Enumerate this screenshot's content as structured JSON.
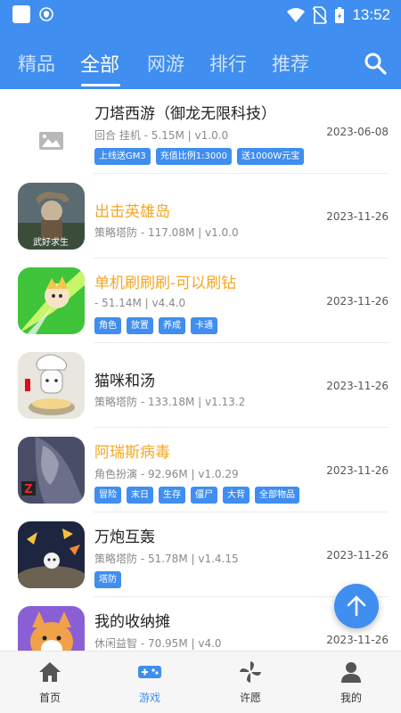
{
  "status_bar": {
    "time": "13:52"
  },
  "tabs": [
    "精品",
    "全部",
    "网游",
    "排行",
    "推荐"
  ],
  "active_tab": "全部",
  "games": [
    {
      "title": "刀塔西游（御龙无限科技）",
      "meta": "回合 挂机 - 5.15M | v1.0.0",
      "date": "2023-06-08",
      "tags": [
        "上线送GM3",
        "充值比例1:3000",
        "送1000W元宝"
      ],
      "highlight": false,
      "icon": "image-placeholder-icon"
    },
    {
      "title": "出击英雄岛",
      "meta": "策略塔防 - 117.08M | v1.0.0",
      "date": "2023-11-26",
      "tags": [],
      "highlight": true,
      "icon": "hero-island-game-icon"
    },
    {
      "title": "单机刷刷刷-可以刷钻",
      "meta": " - 51.14M | v4.4.0",
      "date": "2023-11-26",
      "tags": [
        "角色",
        "放置",
        "养成",
        "卡通"
      ],
      "highlight": true,
      "icon": "green-burst-game-icon"
    },
    {
      "title": "猫咪和汤",
      "meta": "策略塔防 - 133.18M | v1.13.2",
      "date": "2023-11-26",
      "tags": [],
      "highlight": false,
      "icon": "cat-chef-game-icon"
    },
    {
      "title": "阿瑞斯病毒",
      "meta": "角色扮演 - 92.96M | v1.0.29",
      "date": "2023-11-26",
      "tags": [
        "冒险",
        "末日",
        "生存",
        "僵尸",
        "大背",
        "全部物品"
      ],
      "highlight": true,
      "icon": "ares-virus-game-icon"
    },
    {
      "title": "万炮互轰",
      "meta": "策略塔防 - 51.78M | v1.4.15",
      "date": "2023-11-26",
      "tags": [
        "塔防"
      ],
      "highlight": false,
      "icon": "cannon-game-icon"
    },
    {
      "title": "我的收纳摊",
      "meta": "休闲益智 - 70.95M | v4.0",
      "date": "2023-11-26",
      "tags": [],
      "highlight": false,
      "icon": "corgi-game-icon"
    }
  ],
  "bottom_nav": [
    {
      "label": "首页",
      "icon": "home-icon"
    },
    {
      "label": "游戏",
      "icon": "gamepad-icon"
    },
    {
      "label": "许愿",
      "icon": "pinwheel-icon"
    },
    {
      "label": "我的",
      "icon": "user-icon"
    }
  ],
  "active_bottom": "游戏",
  "colors": {
    "primary": "#3f8ef0",
    "highlight_title": "#f5a623"
  }
}
